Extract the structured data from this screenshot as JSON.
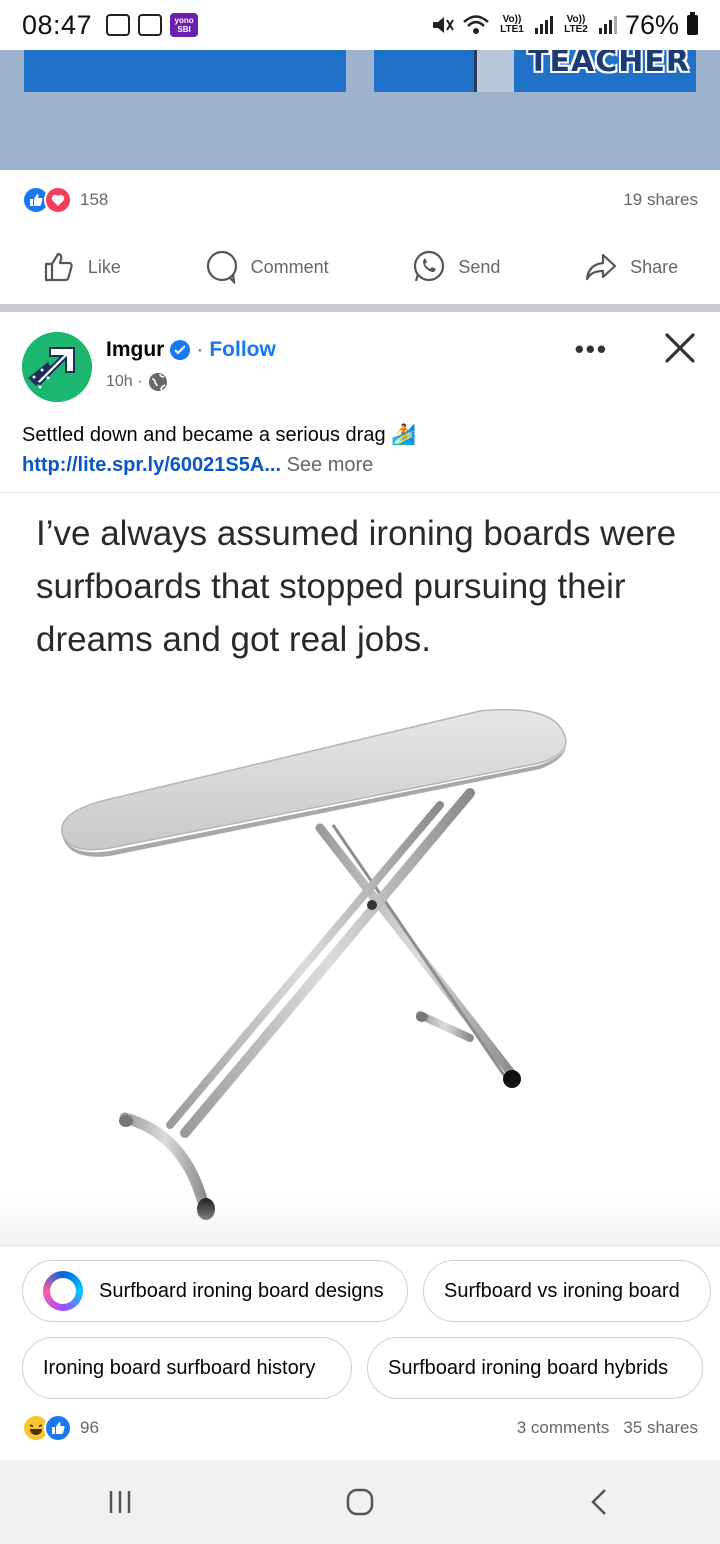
{
  "status_bar": {
    "time": "08:47",
    "yono_label": "yono SBI",
    "sim1": "Vo)) LTE1",
    "sim2": "Vo)) LTE2",
    "battery": "76%"
  },
  "previous_post": {
    "poster_right_text": "TEACHER",
    "reaction_count": "158",
    "shares": "19 shares",
    "actions": {
      "like": "Like",
      "comment": "Comment",
      "send": "Send",
      "share": "Share"
    }
  },
  "post": {
    "author": "Imgur",
    "separator": "·",
    "follow": "Follow",
    "time": "10h ·",
    "text": "Settled down and became a serious drag 🏄",
    "link": "http://lite.spr.ly/60021S5A",
    "ellipsis": "...",
    "see_more": "See more",
    "meme_caption": "I’ve always assumed ironing boards were surfboards that stopped pursuing their dreams and got real jobs.",
    "reaction_count": "96",
    "comments": "3 comments",
    "shares": "35 shares"
  },
  "suggestions": [
    "Surfboard ironing board designs",
    "Surfboard vs ironing board",
    "Ironing board surfboard history",
    "Surfboard ironing board hybrids"
  ],
  "colors": {
    "facebook_blue": "#1877f2",
    "love_red": "#f33e58",
    "muted_text": "#65676b",
    "imgur_green": "#1bb76e"
  }
}
